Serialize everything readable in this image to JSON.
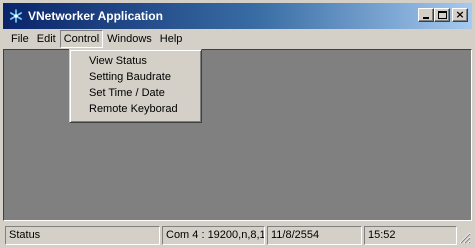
{
  "window": {
    "title": "VNetworker Application",
    "icon": "snowflake-icon"
  },
  "menubar": {
    "items": [
      {
        "label": "File"
      },
      {
        "label": "Edit"
      },
      {
        "label": "Control"
      },
      {
        "label": "Windows"
      },
      {
        "label": "Help"
      }
    ],
    "open_menu": "Control"
  },
  "control_menu": {
    "items": [
      {
        "label": "View Status"
      },
      {
        "label": "Setting Baudrate"
      },
      {
        "label": "Set Time / Date"
      },
      {
        "label": "Remote Keyborad"
      }
    ]
  },
  "statusbar": {
    "status": "Status",
    "port": "Com 4 : 19200,n,8,1",
    "date": "11/8/2554",
    "time": "15:52"
  },
  "colors": {
    "titlebar_start": "#0a246a",
    "titlebar_end": "#a6caf0",
    "client_bg": "#808080",
    "chrome_bg": "#d4d0c8"
  }
}
